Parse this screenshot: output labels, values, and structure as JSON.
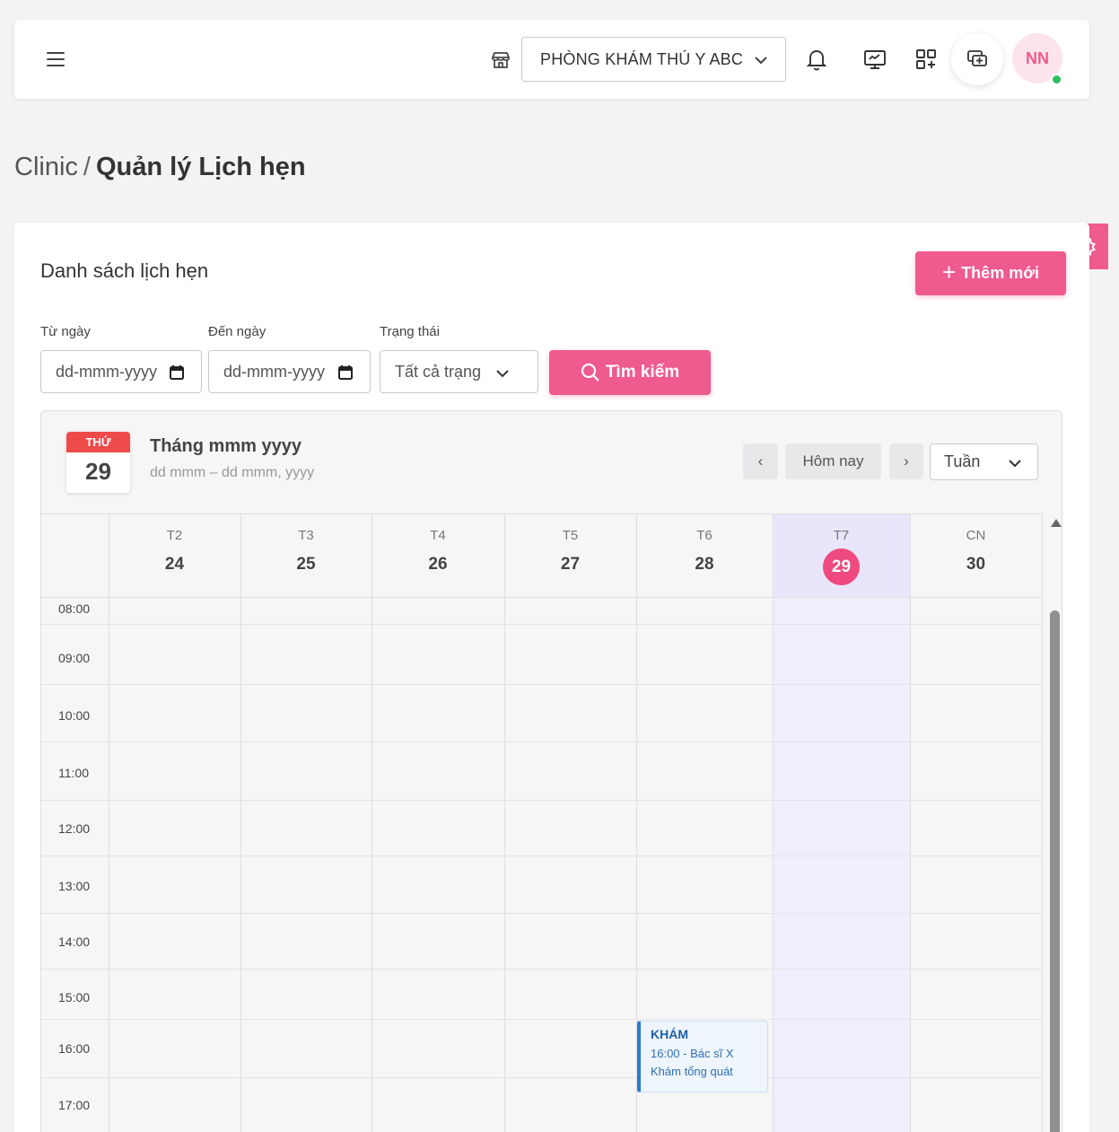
{
  "topbar": {
    "clinic_name": "PHÒNG KHÁM THÚ Y ABC",
    "avatar_initials": "NN"
  },
  "breadcrumb": {
    "root": "Clinic",
    "separator": "/",
    "current": "Quản lý Lịch hẹn"
  },
  "card": {
    "title": "Danh sách lịch hẹn",
    "add_label": "Thêm mới"
  },
  "filters": {
    "from_label": "Từ ngày",
    "from_value": "dd-mmm-yyyy",
    "to_label": "Đến ngày",
    "to_value": "dd-mmm-yyyy",
    "status_label": "Trạng thái",
    "status_value": "Tất cả trạng",
    "search_label": "Tìm kiếm"
  },
  "calendar": {
    "today_weekday": "THỨ",
    "today_day": "29",
    "month_title": "Tháng mmm yyyy",
    "range": "dd mmm – dd mmm, yyyy",
    "prev_label": "‹",
    "today_label": "Hôm nay",
    "next_label": "›",
    "view_label": "Tuần",
    "days": [
      {
        "name": "T2",
        "date": "24"
      },
      {
        "name": "T3",
        "date": "25"
      },
      {
        "name": "T4",
        "date": "26"
      },
      {
        "name": "T5",
        "date": "27"
      },
      {
        "name": "T6",
        "date": "28"
      },
      {
        "name": "T7",
        "date": "29"
      },
      {
        "name": "CN",
        "date": "30"
      }
    ],
    "times": [
      "08:00",
      "09:00",
      "10:00",
      "11:00",
      "12:00",
      "13:00",
      "14:00",
      "15:00",
      "16:00",
      "17:00"
    ],
    "event": {
      "title": "KHÁM",
      "line1": "16:00 - Bác sĩ X",
      "line2": "Khám tổng quát"
    }
  },
  "colors": {
    "accent": "#ef5a8f",
    "today_bg": "#f0eefc",
    "event_border": "#2b7bd1"
  }
}
